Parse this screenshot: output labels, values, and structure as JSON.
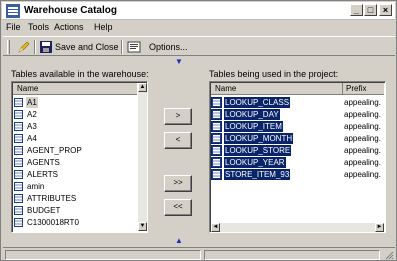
{
  "window": {
    "title": "Warehouse Catalog"
  },
  "title_buttons": {
    "minimize": "_",
    "maximize": "□",
    "close": "×"
  },
  "menu": {
    "items": [
      "File",
      "Tools",
      "Actions",
      "Help"
    ]
  },
  "toolbar": {
    "save_close_label": "Save and Close",
    "options_label": "Options..."
  },
  "left_panel": {
    "label": "Tables available in the warehouse:",
    "column_header": "Name",
    "items": [
      "A1",
      "A2",
      "A3",
      "A4",
      "AGENT_PROP",
      "AGENTS",
      "ALERTS",
      "amin",
      "ATTRIBUTES",
      "BUDGET",
      "C1300018RT0"
    ]
  },
  "right_panel": {
    "label": "Tables being used in the project:",
    "columns": [
      "Name",
      "Prefix"
    ],
    "items": [
      {
        "name": "LOOKUP_CLASS",
        "prefix": "appealing."
      },
      {
        "name": "LOOKUP_DAY",
        "prefix": "appealing."
      },
      {
        "name": "LOOKUP_ITEM",
        "prefix": "appealing."
      },
      {
        "name": "LOOKUP_MONTH",
        "prefix": "appealing."
      },
      {
        "name": "LOOKUP_STORE",
        "prefix": "appealing."
      },
      {
        "name": "LOOKUP_YEAR",
        "prefix": "appealing."
      },
      {
        "name": "STORE_ITEM_93",
        "prefix": "appealing."
      }
    ]
  },
  "transfer_buttons": {
    "add": ">",
    "remove": "<",
    "add_all": ">>",
    "remove_all": "<<"
  },
  "colors": {
    "selection": "#0a246a",
    "chrome": "#d4d0c8",
    "arrow": "#1c2db8"
  }
}
